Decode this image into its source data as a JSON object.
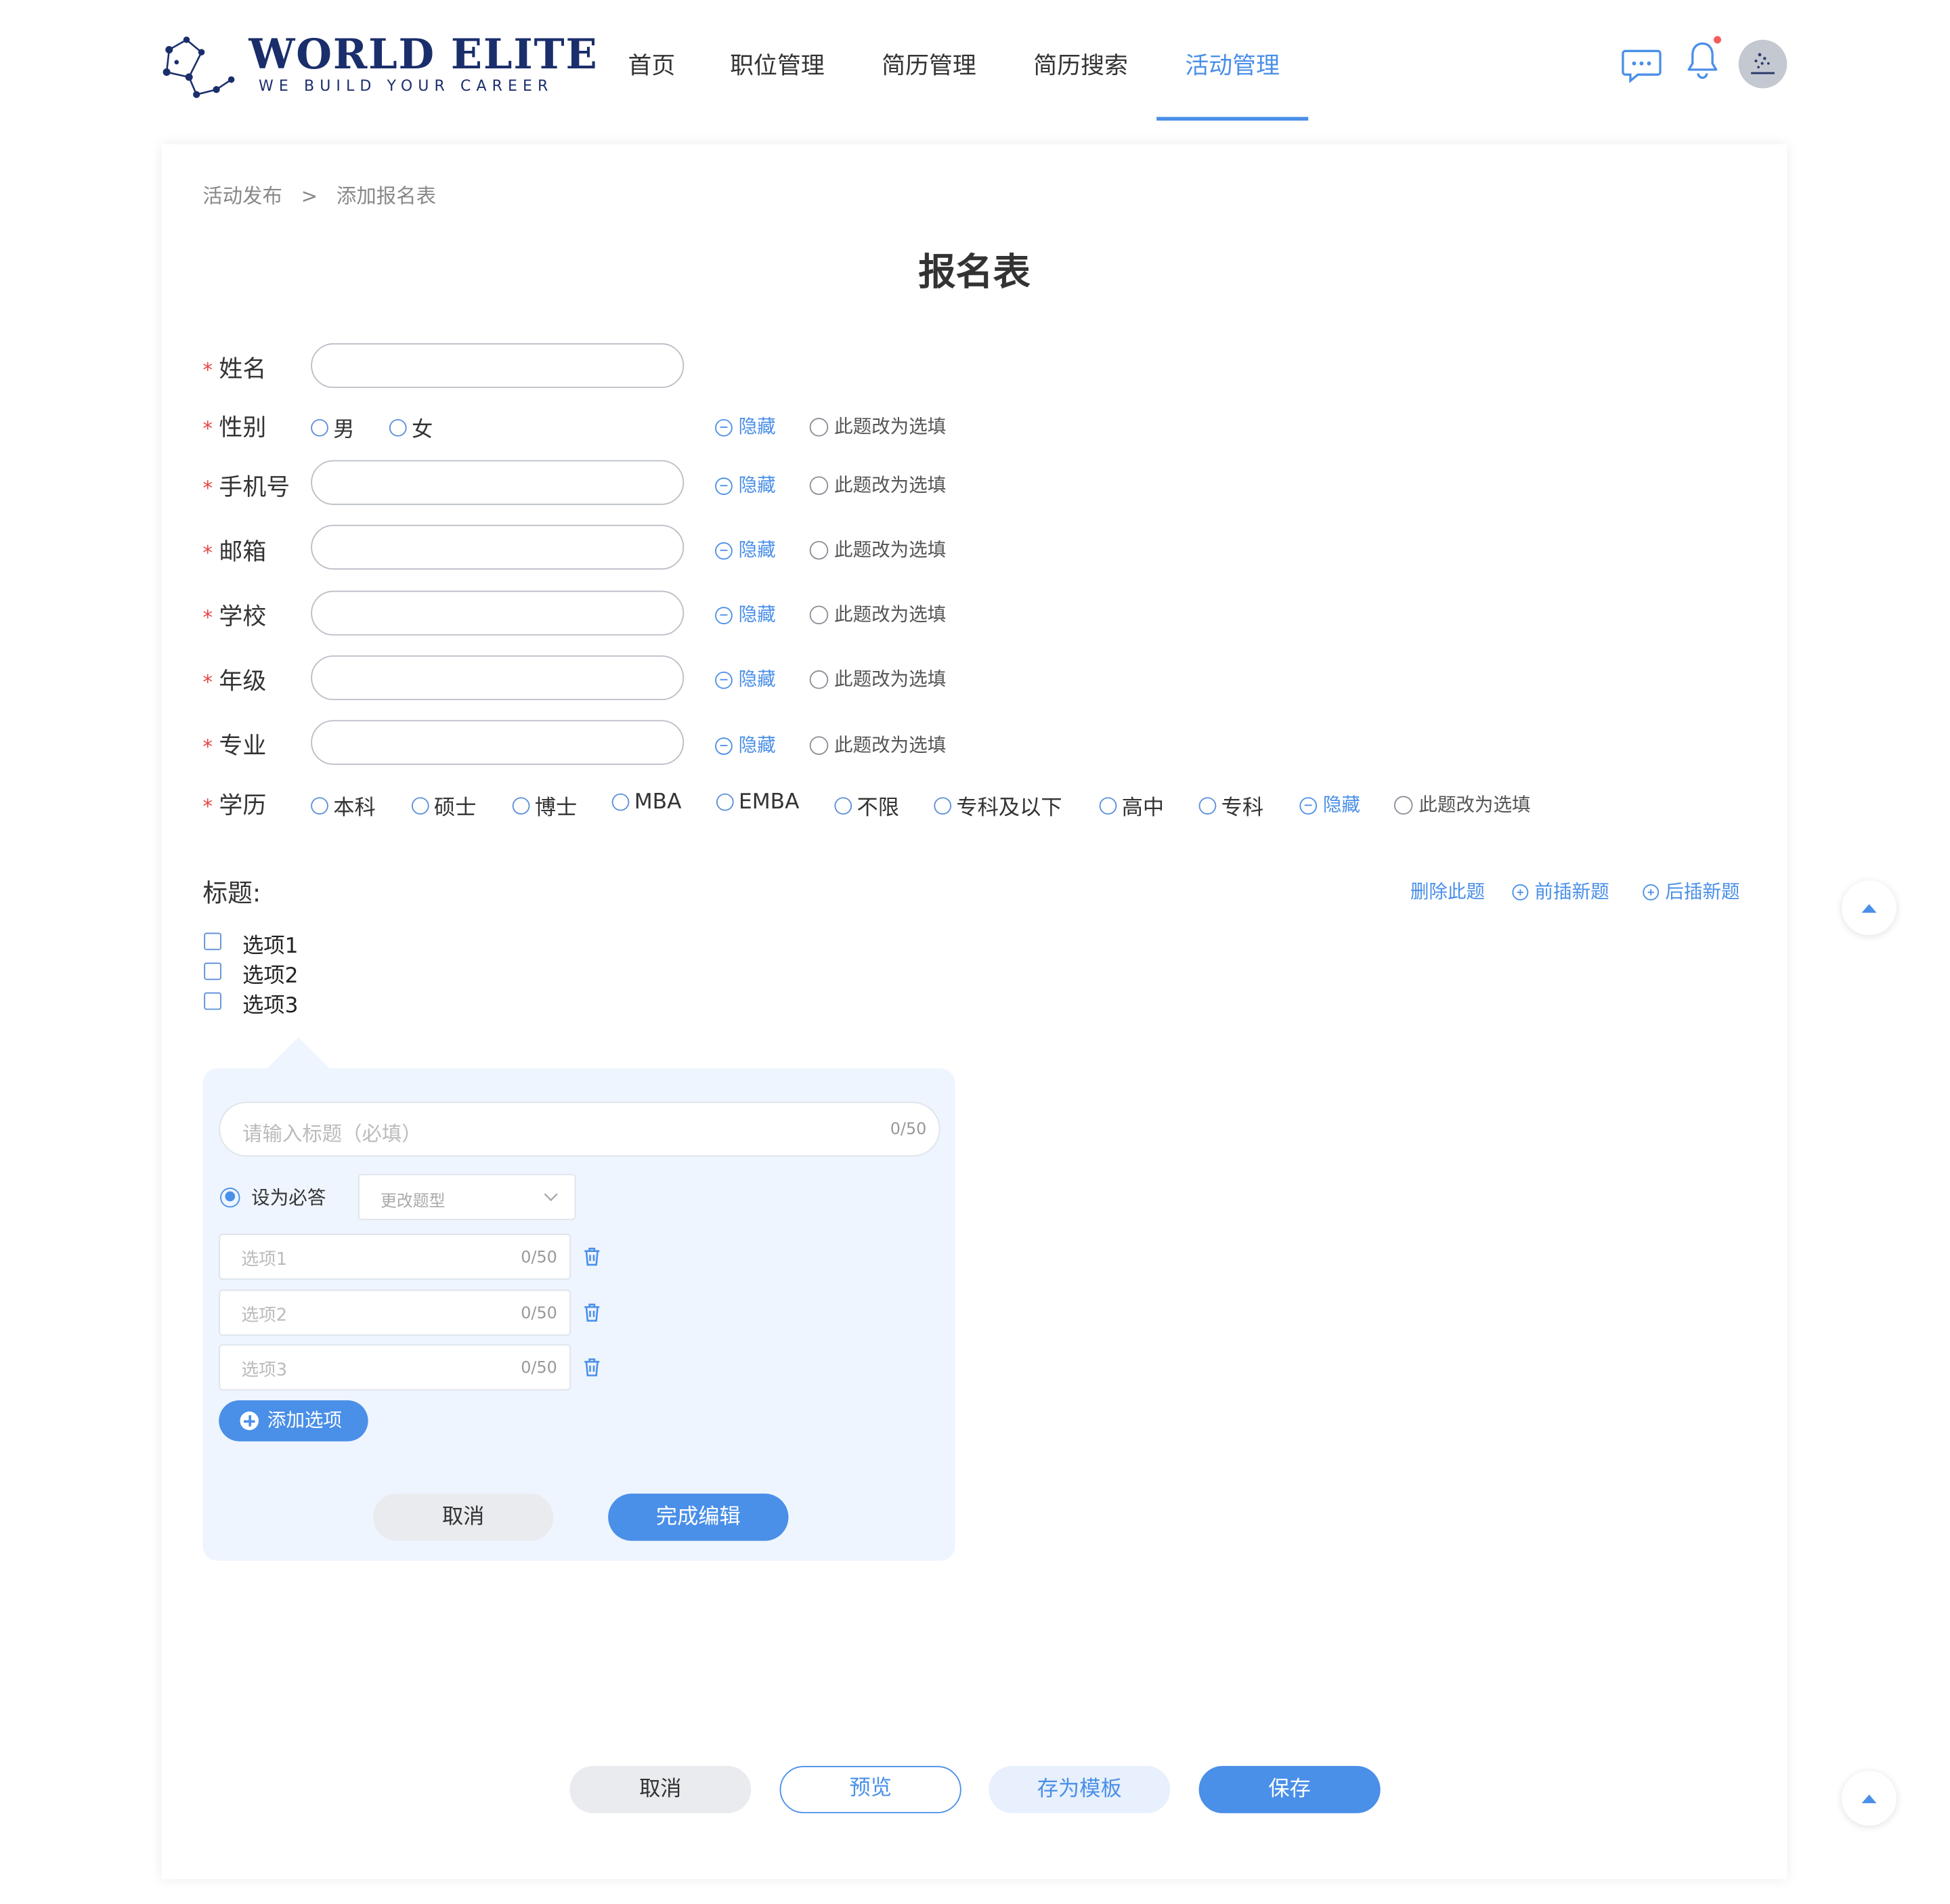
{
  "brand": {
    "title": "WORLD ELITE",
    "subtitle": "WE BUILD YOUR CAREER",
    "accent": "#4a8fe8",
    "logo_color": "#1a2e6b"
  },
  "nav": {
    "items": [
      {
        "label": "首页",
        "active": false
      },
      {
        "label": "职位管理",
        "active": false
      },
      {
        "label": "简历管理",
        "active": false
      },
      {
        "label": "简历搜索",
        "active": false
      },
      {
        "label": "活动管理",
        "active": true
      }
    ],
    "icons": [
      "chat-icon",
      "bell-icon",
      "avatar"
    ]
  },
  "breadcrumb": {
    "items": [
      "活动发布",
      "添加报名表"
    ],
    "separator": ">"
  },
  "page_title": "报名表",
  "required_mark": "*",
  "common": {
    "hide_label": "隐藏",
    "optional_label": "此题改为选填"
  },
  "fields": [
    {
      "label": "姓名",
      "type": "text"
    },
    {
      "label": "性别",
      "type": "radio",
      "options": [
        "男",
        "女"
      ]
    },
    {
      "label": "手机号",
      "type": "text"
    },
    {
      "label": "邮箱",
      "type": "text"
    },
    {
      "label": "学校",
      "type": "text"
    },
    {
      "label": "年级",
      "type": "text"
    },
    {
      "label": "专业",
      "type": "text"
    },
    {
      "label": "学历",
      "type": "radio",
      "options": [
        "本科",
        "硕士",
        "博士",
        "MBA",
        "EMBA",
        "不限",
        "专科及以下",
        "高中",
        "专科"
      ]
    }
  ],
  "question": {
    "title_label": "标题:",
    "actions": {
      "delete": "删除此题",
      "insert_before": "前插新题",
      "insert_after": "后插新题"
    },
    "options": [
      "选项1",
      "选项2",
      "选项3"
    ]
  },
  "editor": {
    "title_placeholder": "请输入标题（必填）",
    "title_counter": "0/50",
    "required_label": "设为必答",
    "required_checked": true,
    "type_select_placeholder": "更改题型",
    "option_inputs": [
      {
        "placeholder": "选项1",
        "counter": "0/50"
      },
      {
        "placeholder": "选项2",
        "counter": "0/50"
      },
      {
        "placeholder": "选项3",
        "counter": "0/50"
      }
    ],
    "add_option_label": "添加选项",
    "cancel_label": "取消",
    "done_label": "完成编辑"
  },
  "footer_buttons": {
    "cancel": "取消",
    "preview": "预览",
    "save_template": "存为模板",
    "save": "保存"
  }
}
